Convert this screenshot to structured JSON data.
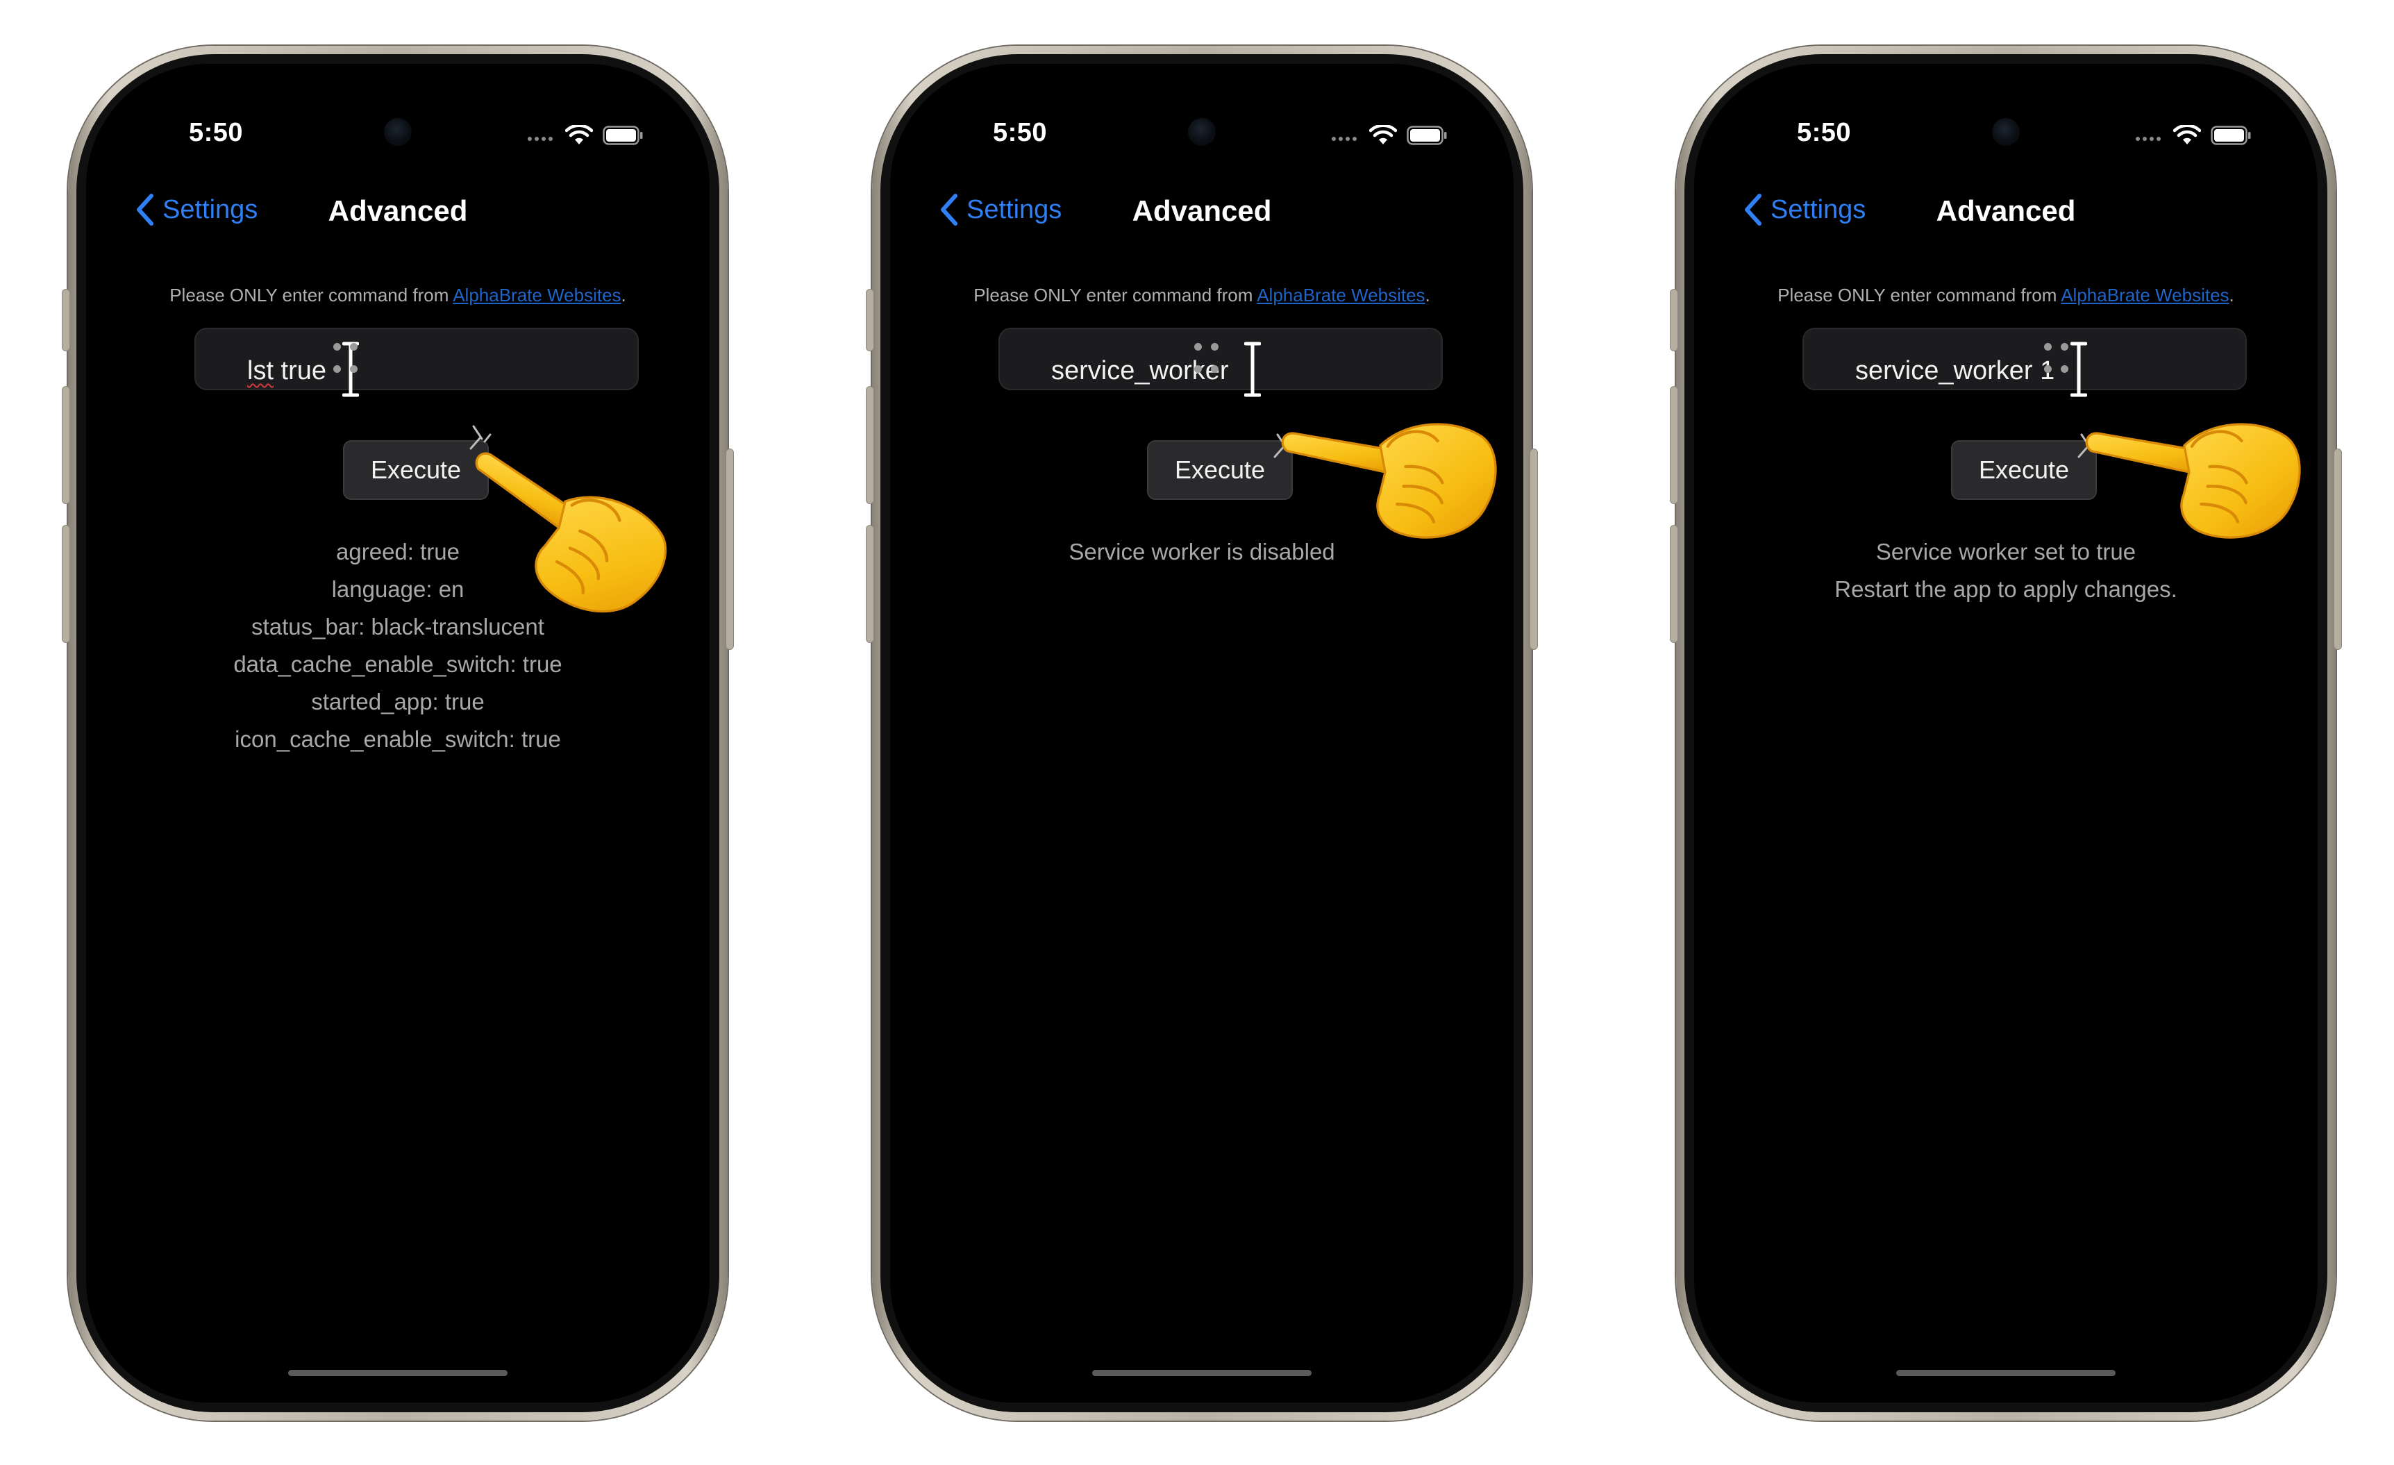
{
  "status_bar": {
    "time": "5:50"
  },
  "nav": {
    "back_label": "Settings",
    "title": "Advanced"
  },
  "notice": {
    "prefix": "Please ONLY enter command from ",
    "link": "AlphaBrate Websites",
    "suffix": "."
  },
  "execute_label": "Execute",
  "screens": [
    {
      "input_part1": "lst",
      "input_part2": " true",
      "output_lines": [
        "agreed: true",
        "language: en",
        "status_bar: black-translucent",
        "data_cache_enable_switch: true",
        "started_app: true",
        "icon_cache_enable_switch: true"
      ]
    },
    {
      "input_value": "service_worker",
      "output_lines": [
        "Service worker is disabled"
      ]
    },
    {
      "input_value": "service_worker 1",
      "output_lines": [
        "Service worker set to true",
        "Restart the app to apply changes."
      ]
    }
  ],
  "colors": {
    "accent": "#2f7ff5",
    "link": "#1f64c8",
    "screen_bg": "#000000",
    "frame": "#c9c2b6",
    "hand": "#f7c21c"
  }
}
